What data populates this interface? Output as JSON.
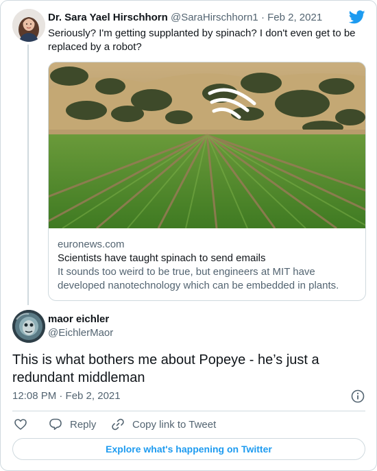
{
  "quoted_tweet": {
    "author_name": "Dr. Sara Yael Hirschhorn",
    "handle": "@SaraHirschhorn1",
    "separator": "·",
    "date": "Feb 2, 2021",
    "text": "Seriously? I'm getting supplanted by spinach? I don't even get to be replaced by a robot?",
    "link_card": {
      "domain": "euronews.com",
      "title": "Scientists have taught spinach to send emails",
      "description": "It sounds too weird to be true, but engineers at MIT have developed nanotechnology which can be embedded in plants."
    }
  },
  "main_tweet": {
    "author_name": "maor eichler",
    "handle": "@EichlerMaor",
    "text": "This is what bothers me about Popeye - he’s just a redundant middleman",
    "timestamp": "12:08 PM · Feb 2, 2021"
  },
  "actions": {
    "reply_label": "Reply",
    "copy_link_label": "Copy link to Tweet"
  },
  "explore_button_label": "Explore what's happening on Twitter",
  "icons": {
    "twitter": "twitter-bird-icon",
    "like": "heart-icon",
    "reply": "reply-bubble-icon",
    "copy_link": "link-icon",
    "info": "info-icon"
  },
  "colors": {
    "brand_blue": "#1d9bf0",
    "text_primary": "#0f1419",
    "text_secondary": "#536471",
    "border": "#cfd9de"
  }
}
